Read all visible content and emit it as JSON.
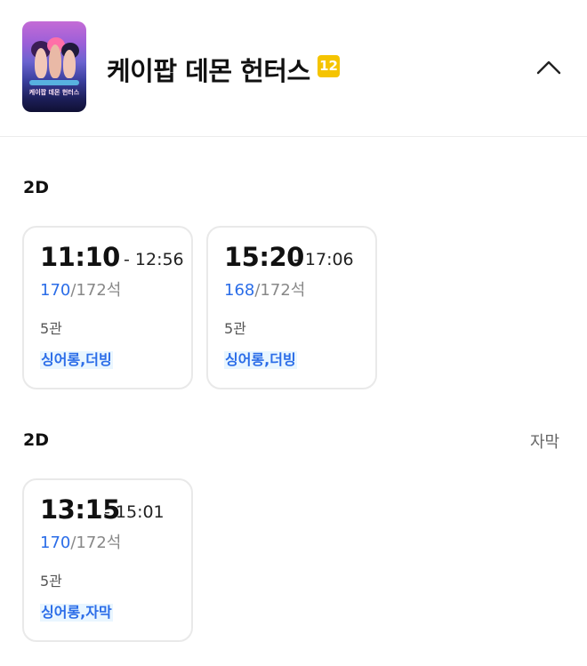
{
  "movie": {
    "title": "케이팝 데몬 헌터스",
    "age_rating": "12",
    "poster_icon": "movie-poster",
    "poster_text": "케이팝 데몬 헌터스"
  },
  "sections": [
    {
      "format": "2D",
      "note": "",
      "showtimes": [
        {
          "start": "11:10",
          "end": "- 12:56",
          "available": "170",
          "total": "/172석",
          "hall": "5관",
          "tag": "싱어롱,더빙"
        },
        {
          "start": "15:20",
          "end": "- 17:06",
          "available": "168",
          "total": "/172석",
          "hall": "5관",
          "tag": "싱어롱,더빙"
        }
      ]
    },
    {
      "format": "2D",
      "note": "자막",
      "showtimes": [
        {
          "start": "13:15",
          "end": "- 15:01",
          "available": "170",
          "total": "/172석",
          "hall": "5관",
          "tag": "싱어롱,자막"
        }
      ]
    }
  ],
  "colors": {
    "accent_blue": "#2b6de8",
    "tag_bg": "#e9f6ff",
    "age_badge": "#f5c400"
  }
}
